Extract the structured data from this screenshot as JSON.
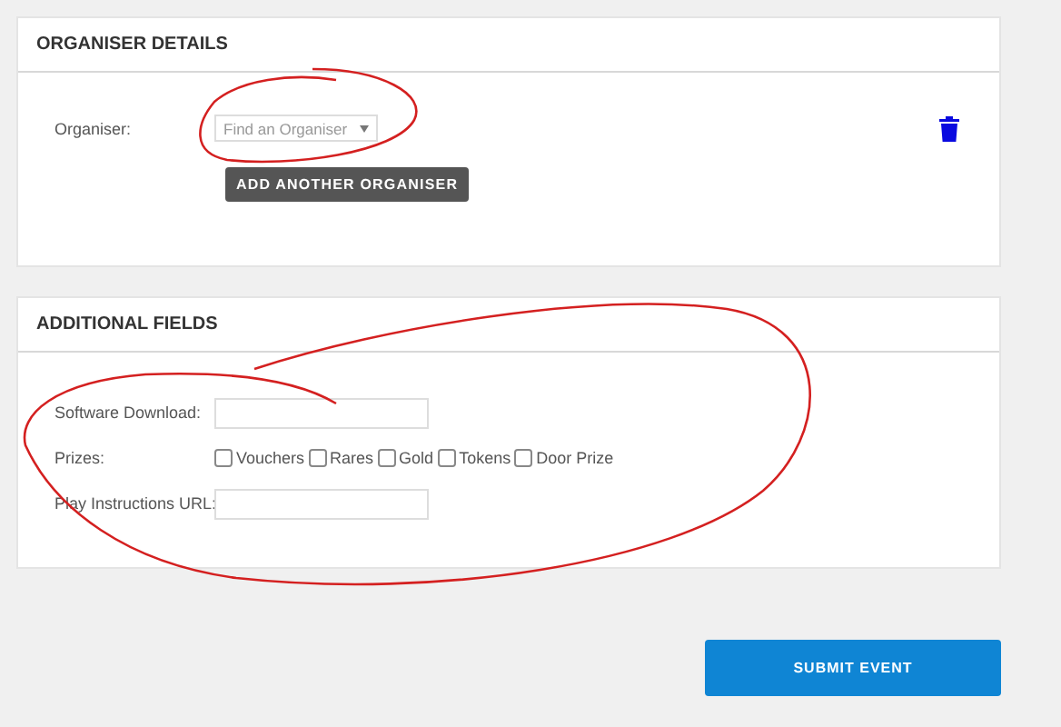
{
  "organiser_details": {
    "title": "ORGANISER DETAILS",
    "organiser_label": "Organiser:",
    "organiser_select": {
      "placeholder": "Find an Organiser"
    },
    "add_button": "ADD ANOTHER ORGANISER"
  },
  "additional_fields": {
    "title": "ADDITIONAL FIELDS",
    "software_download_label": "Software Download:",
    "prizes_label": "Prizes:",
    "prizes": [
      {
        "label": "Vouchers",
        "checked": false
      },
      {
        "label": "Rares",
        "checked": false
      },
      {
        "label": "Gold",
        "checked": false
      },
      {
        "label": "Tokens",
        "checked": false
      },
      {
        "label": "Door Prize",
        "checked": false
      }
    ],
    "play_instructions_label": "Play Instructions URL:"
  },
  "submit_button": "SUBMIT EVENT"
}
